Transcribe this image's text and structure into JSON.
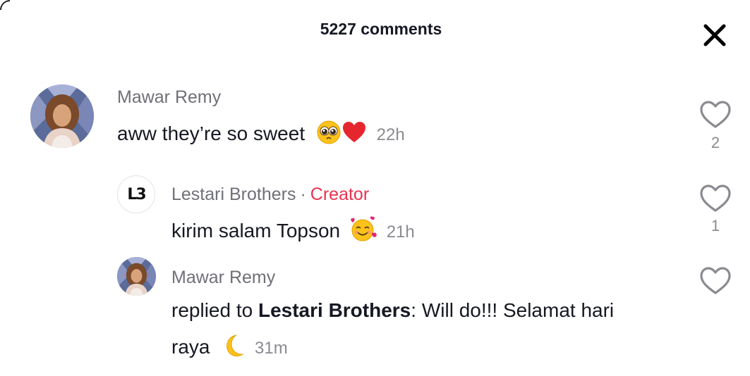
{
  "header": {
    "title": "5227 comments",
    "close_icon": "close-icon"
  },
  "comments": [
    {
      "author": "Mawar Remy",
      "text": "aww they’re so sweet",
      "emojis": [
        "pleading-face",
        "red-heart"
      ],
      "time": "22h",
      "likes": "2",
      "avatar_icon": "user-avatar"
    },
    {
      "author": "Lestari Brothers",
      "separator": "·",
      "badge": "Creator",
      "badge_color": "#e8344f",
      "text": "kirim salam Topson",
      "emojis": [
        "smiling-face-with-hearts"
      ],
      "time": "21h",
      "likes": "1",
      "avatar_logo": "L3"
    },
    {
      "author": "Mawar Remy",
      "reply_prefix": "replied to ",
      "reply_target": "Lestari Brothers",
      "reply_colon": ":",
      "text_line1": " Will do!!! Selamat hari",
      "text_line2": "raya",
      "emojis": [
        "crescent-moon"
      ],
      "time": "31m",
      "avatar_icon": "user-avatar"
    }
  ]
}
